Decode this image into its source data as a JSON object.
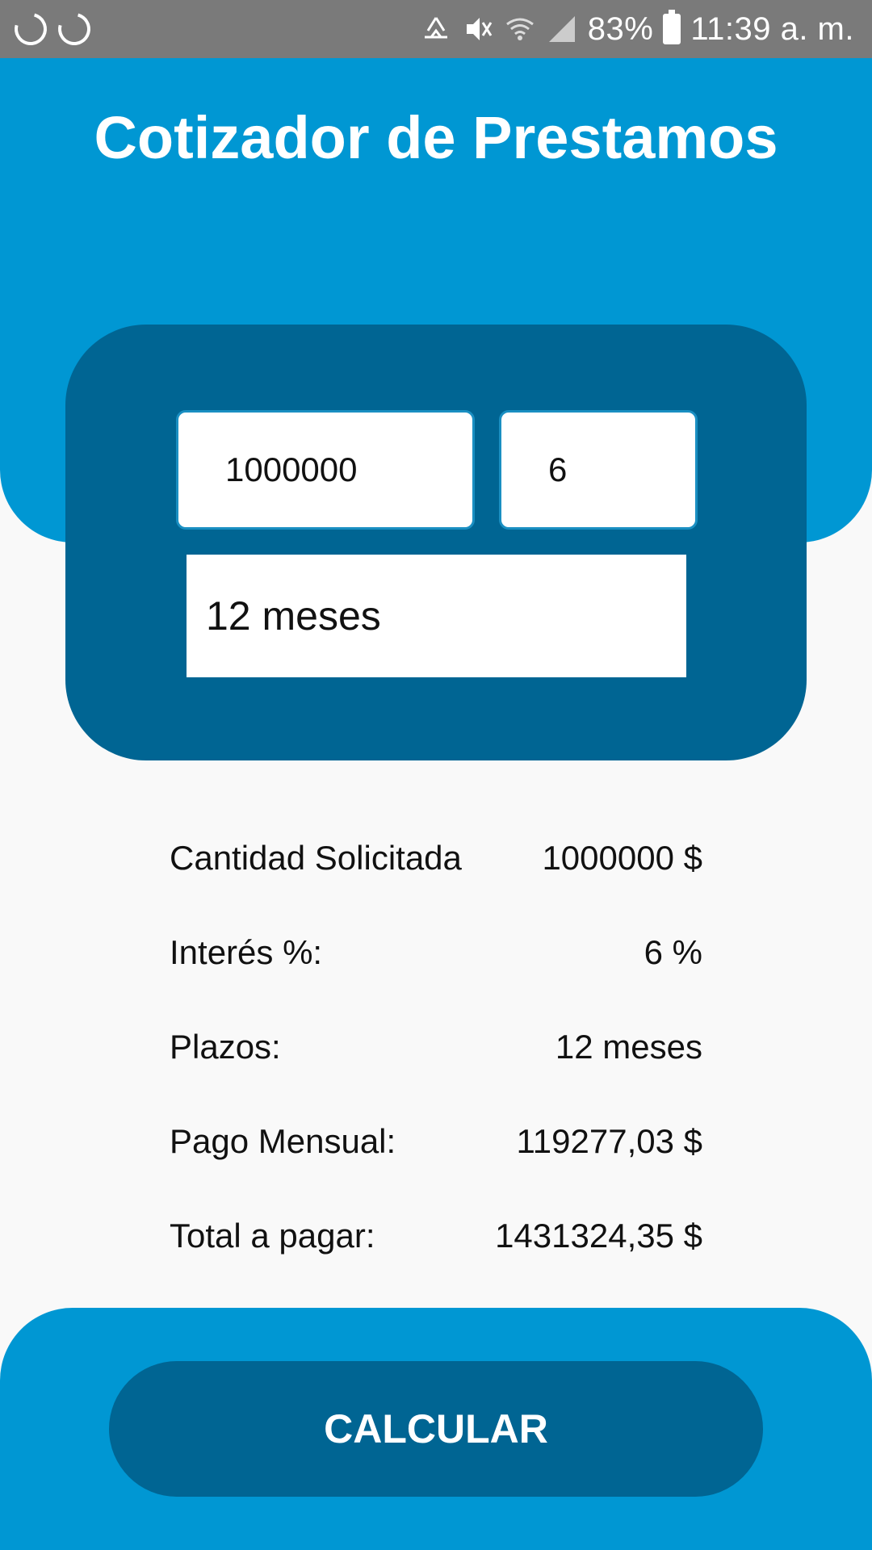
{
  "status_bar": {
    "battery": "83%",
    "time": "11:39 a. m."
  },
  "header": {
    "title": "Cotizador de Prestamos"
  },
  "form": {
    "amount_value": "1000000",
    "interest_value": "6",
    "term_selected": "12 meses"
  },
  "summary": {
    "rows": [
      {
        "label": "Cantidad Solicitada",
        "value": "1000000 $"
      },
      {
        "label": "Interés %:",
        "value": "6 %"
      },
      {
        "label": "Plazos:",
        "value": "12 meses"
      },
      {
        "label": "Pago Mensual:",
        "value": "119277,03 $"
      },
      {
        "label": "Total a pagar:",
        "value": "1431324,35 $"
      }
    ]
  },
  "footer": {
    "button_label": "CALCULAR"
  },
  "colors": {
    "primary": "#0097d3",
    "dark": "#006593",
    "background": "#f9f9f9",
    "status_bar": "#7a7a7a"
  },
  "icons": [
    "loading-spinner-icon",
    "recycle-icon",
    "mute-icon",
    "wifi-icon",
    "cell-signal-icon",
    "battery-icon"
  ]
}
